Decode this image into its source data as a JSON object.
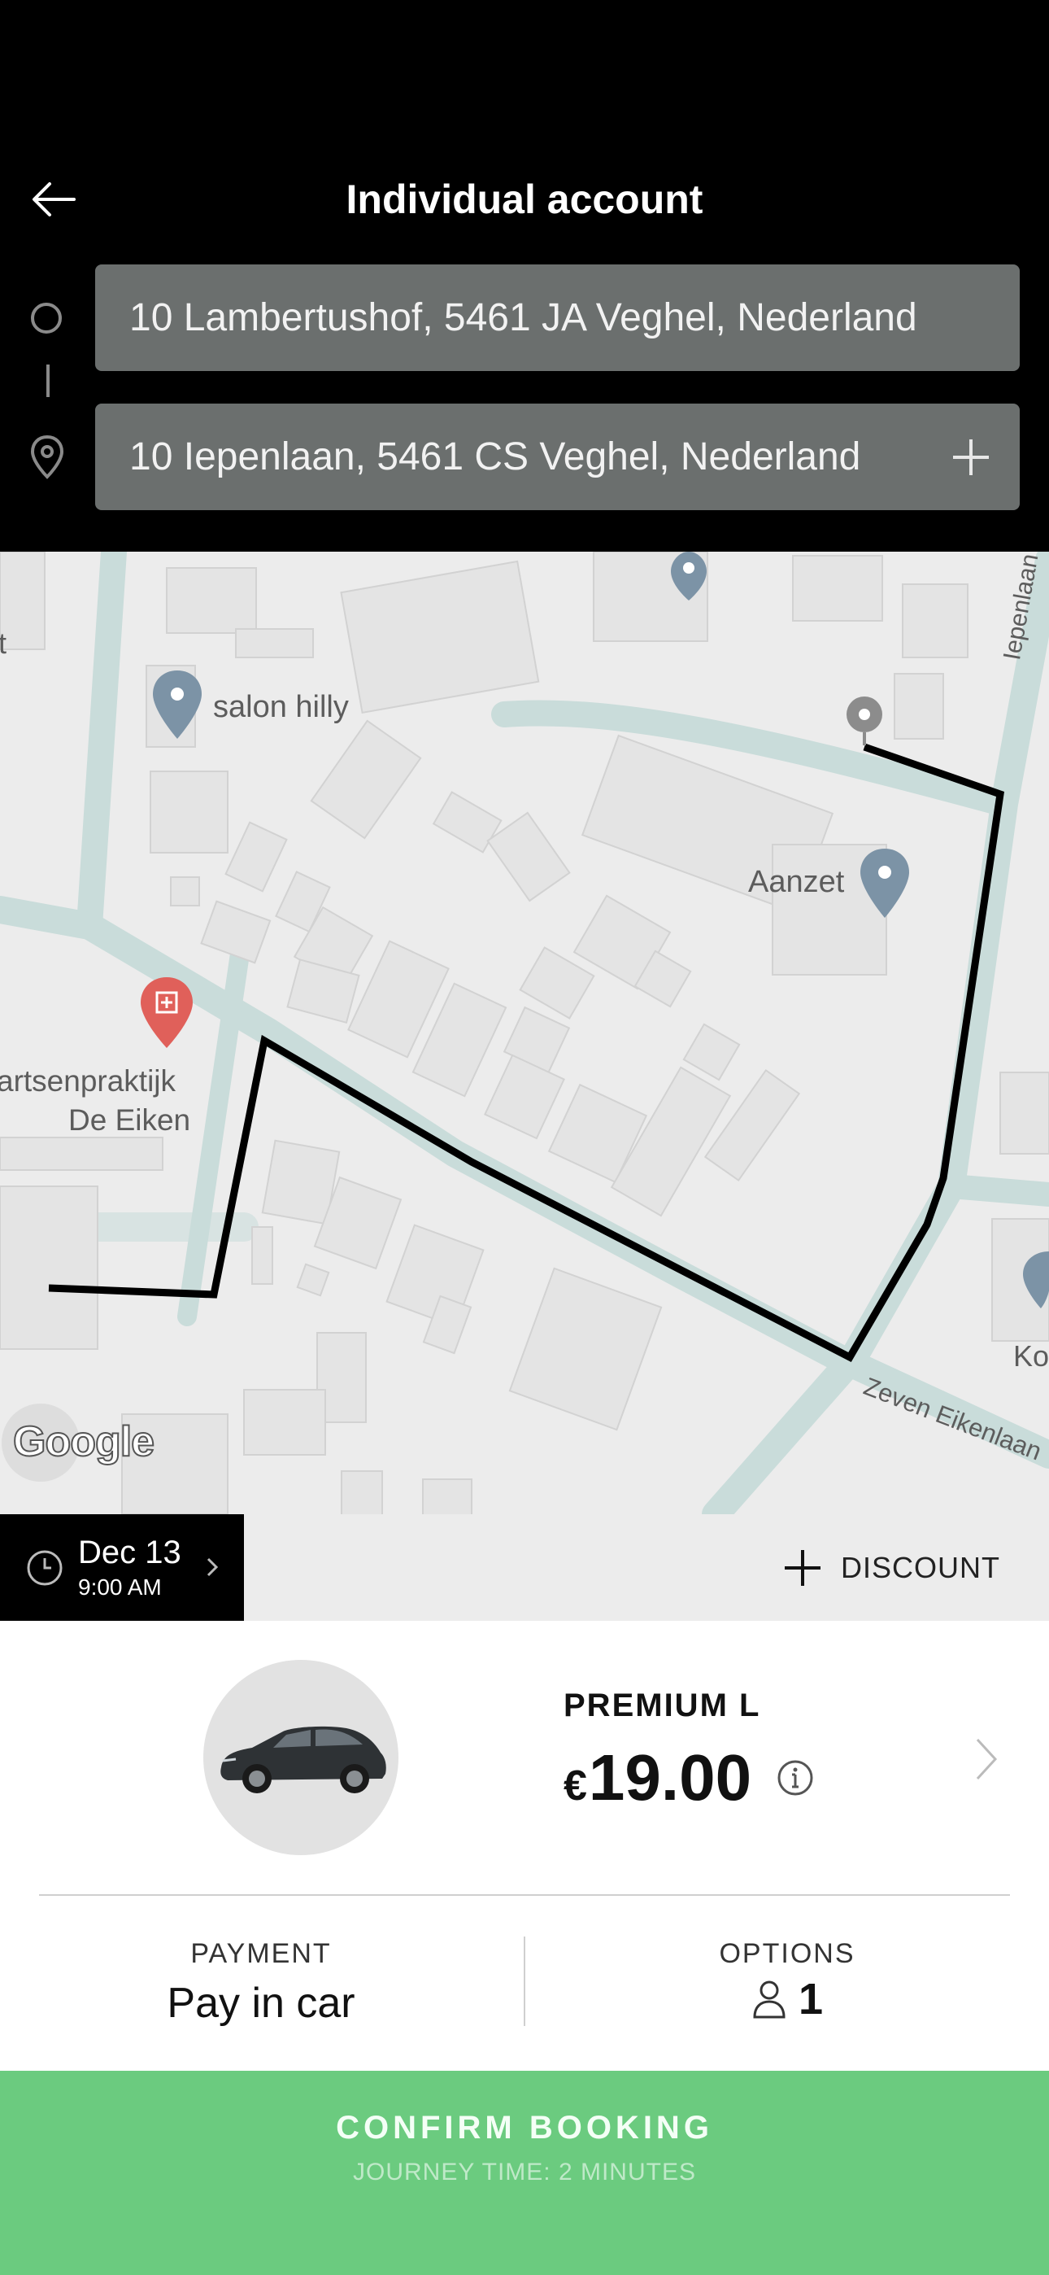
{
  "header": {
    "title": "Individual account",
    "from_address": "10 Lambertushof, 5461 JA Veghel, Nederland",
    "to_address": "10 Iepenlaan, 5461 CS Veghel, Nederland"
  },
  "map": {
    "labels": {
      "salon": "salon hilly",
      "aanzet": "Aanzet",
      "practice_line1": "artsenpraktijk",
      "practice_line2": "De Eiken",
      "street_iepenlaan": "Iepenlaan",
      "street_zeven": "Zeven Eikenlaan",
      "partial_left": "t",
      "partial_right": "Ko",
      "google": "Google"
    }
  },
  "schedule": {
    "date": "Dec 13",
    "time": "9:00 AM",
    "discount_label": "DISCOUNT"
  },
  "ride": {
    "service": "PREMIUM L",
    "currency": "€",
    "price": "19.00",
    "payment_label": "PAYMENT",
    "payment_value": "Pay in car",
    "options_label": "OPTIONS",
    "passengers": "1"
  },
  "confirm": {
    "label": "CONFIRM BOOKING",
    "sub": "JOURNEY TIME: 2 MINUTES"
  },
  "colors": {
    "confirm_green": "#6bcb7f",
    "field_gray": "#6b6f6e",
    "road_teal": "#c9dcda",
    "route_black": "#000000"
  }
}
